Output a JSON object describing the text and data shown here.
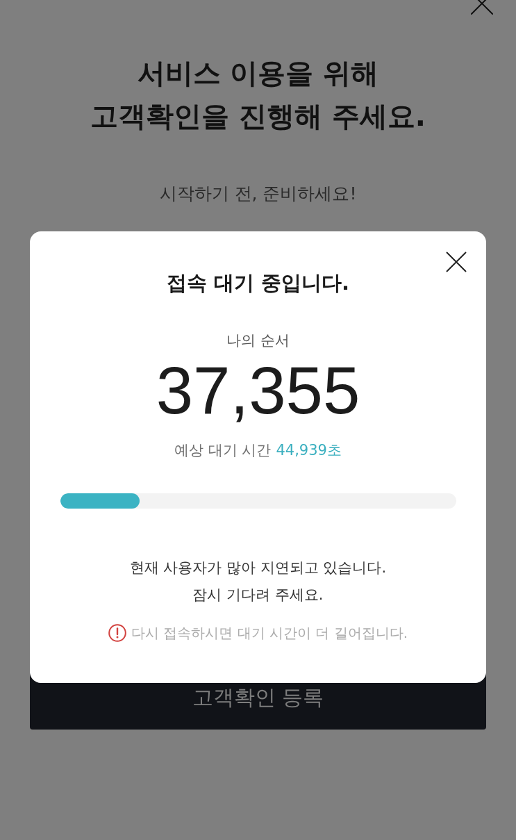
{
  "page": {
    "title": "서비스 이용을 위해\n고객확인을 진행해 주세요.",
    "subtitle": "시작하기 전, 준비하세요!",
    "button": "고객확인 등록"
  },
  "dialog": {
    "title": "접속 대기 중입니다.",
    "queue_label": "나의 순서",
    "queue_number": "37,355",
    "wait_label": "예상 대기 시간",
    "wait_value": "44,939초",
    "progress": {
      "level": 0.2
    },
    "message": "현재 사용자가 많아 지연되고 있습니다.\n잠시 기다려 주세요.",
    "warning": "다시 접속하시면 대기 시간이 더 길어집니다."
  }
}
